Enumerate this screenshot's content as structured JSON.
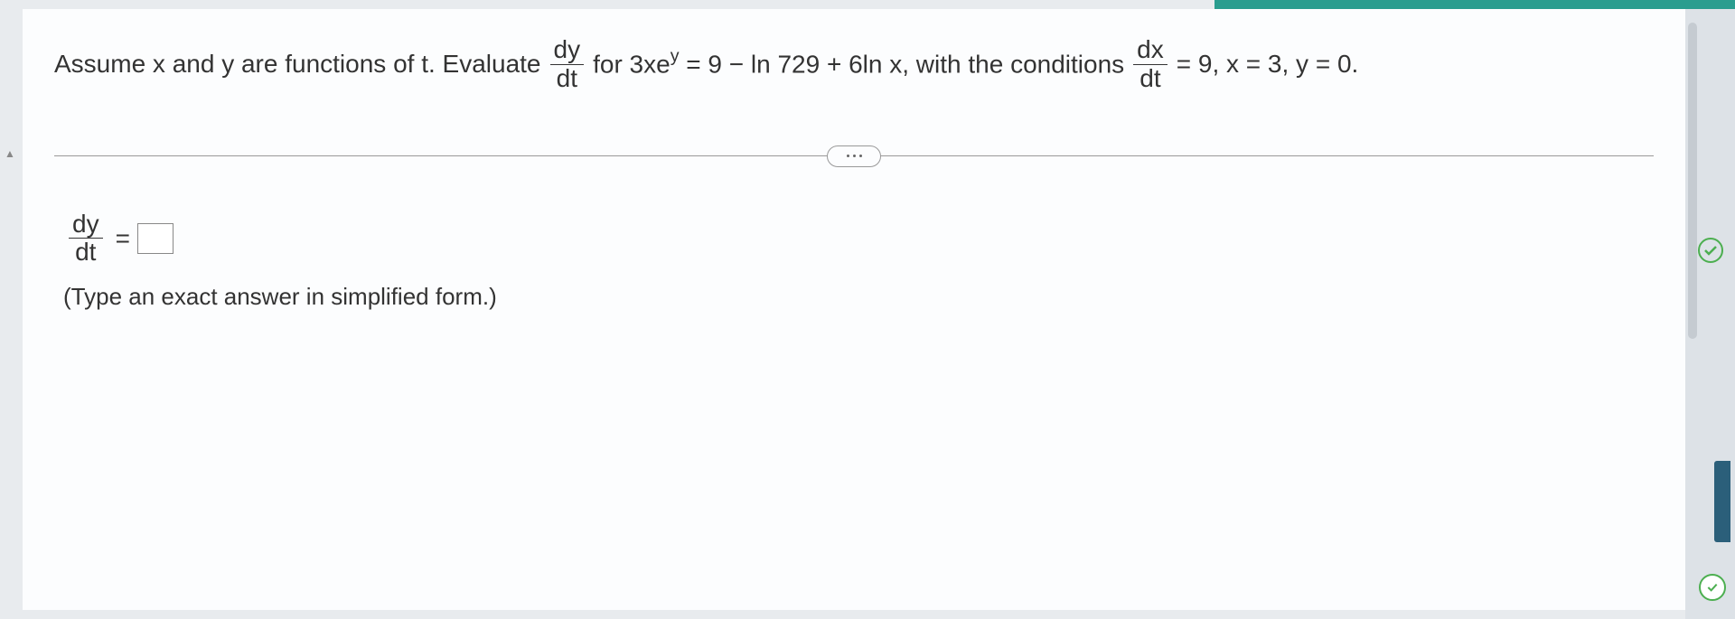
{
  "question": {
    "part1": "Assume x and y are functions of t. Evaluate",
    "frac1_num": "dy",
    "frac1_den": "dt",
    "part2": "for 3xe",
    "exp1": "y",
    "part3": " = 9 − ln 729 + 6ln x, with the conditions",
    "frac2_num": "dx",
    "frac2_den": "dt",
    "part4": " = 9,  x = 3,  y = 0."
  },
  "answer": {
    "frac_num": "dy",
    "frac_den": "dt",
    "equals": "="
  },
  "instruction": "(Type an exact answer in simplified form.)"
}
